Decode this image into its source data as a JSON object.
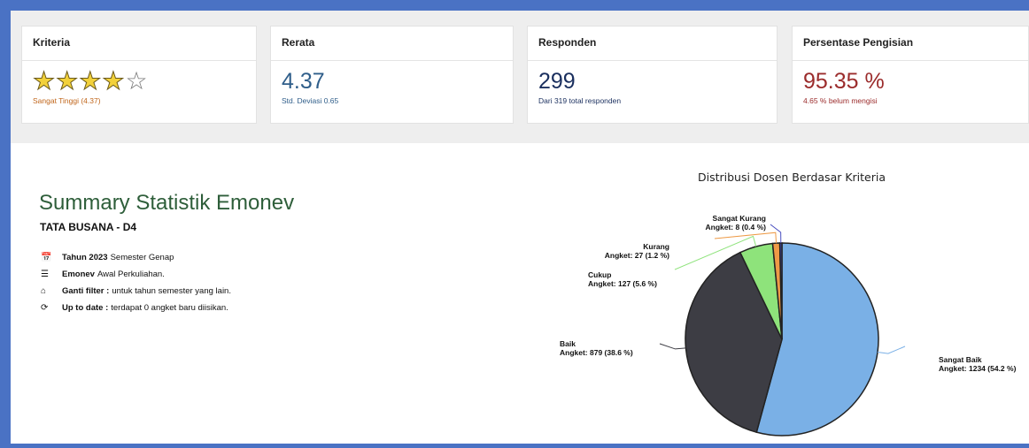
{
  "cards": [
    {
      "title": "Kriteria",
      "stars_filled": 4,
      "stars_total": 5,
      "note": "Sangat Tinggi (4.37)",
      "note_color": "#c0651a"
    },
    {
      "title": "Rerata",
      "value": "4.37",
      "note": "Std. Deviasi 0.65",
      "color": "#2f5e8a"
    },
    {
      "title": "Responden",
      "value": "299",
      "note": "Dari 319 total responden",
      "color": "#1a2f5e"
    },
    {
      "title": "Persentase Pengisian",
      "value": "95.35 %",
      "note": "4.65 % belum mengisi",
      "color": "#9b2c2c"
    }
  ],
  "summary": {
    "title": "Summary Statistik Emonev",
    "subtitle": "TATA BUSANA - D4",
    "items": [
      {
        "icon": "calendar-icon",
        "glyph": "📅",
        "bold": "Tahun 2023",
        "text": "Semester Genap"
      },
      {
        "icon": "list-icon",
        "glyph": "☰",
        "bold": "Emonev",
        "text": "Awal Perkuliahan."
      },
      {
        "icon": "home-icon",
        "glyph": "⌂",
        "bold": "Ganti filter :",
        "text": "untuk tahun semester yang lain."
      },
      {
        "icon": "refresh-icon",
        "glyph": "⟳",
        "bold": "Up to date :",
        "text": "terdapat 0 angket baru diisikan."
      }
    ]
  },
  "chart_data": {
    "type": "pie",
    "title": "Distribusi Dosen Berdasar Kriteria",
    "slices": [
      {
        "name": "Sangat Baik",
        "label": "Angket: 1234 (54.2 %)",
        "value": 1234,
        "color": "#7ab0e6"
      },
      {
        "name": "Baik",
        "label": "Angket: 879 (38.6 %)",
        "value": 879,
        "color": "#3d3d44"
      },
      {
        "name": "Cukup",
        "label": "Angket: 127 (5.6 %)",
        "value": 127,
        "color": "#8ee37b"
      },
      {
        "name": "Kurang",
        "label": "Angket: 27 (1.2 %)",
        "value": 27,
        "color": "#ee9a46"
      },
      {
        "name": "Sangat Kurang",
        "label": "Angket: 8 (0.4 %)",
        "value": 8,
        "color": "#4a4fc0"
      }
    ]
  }
}
